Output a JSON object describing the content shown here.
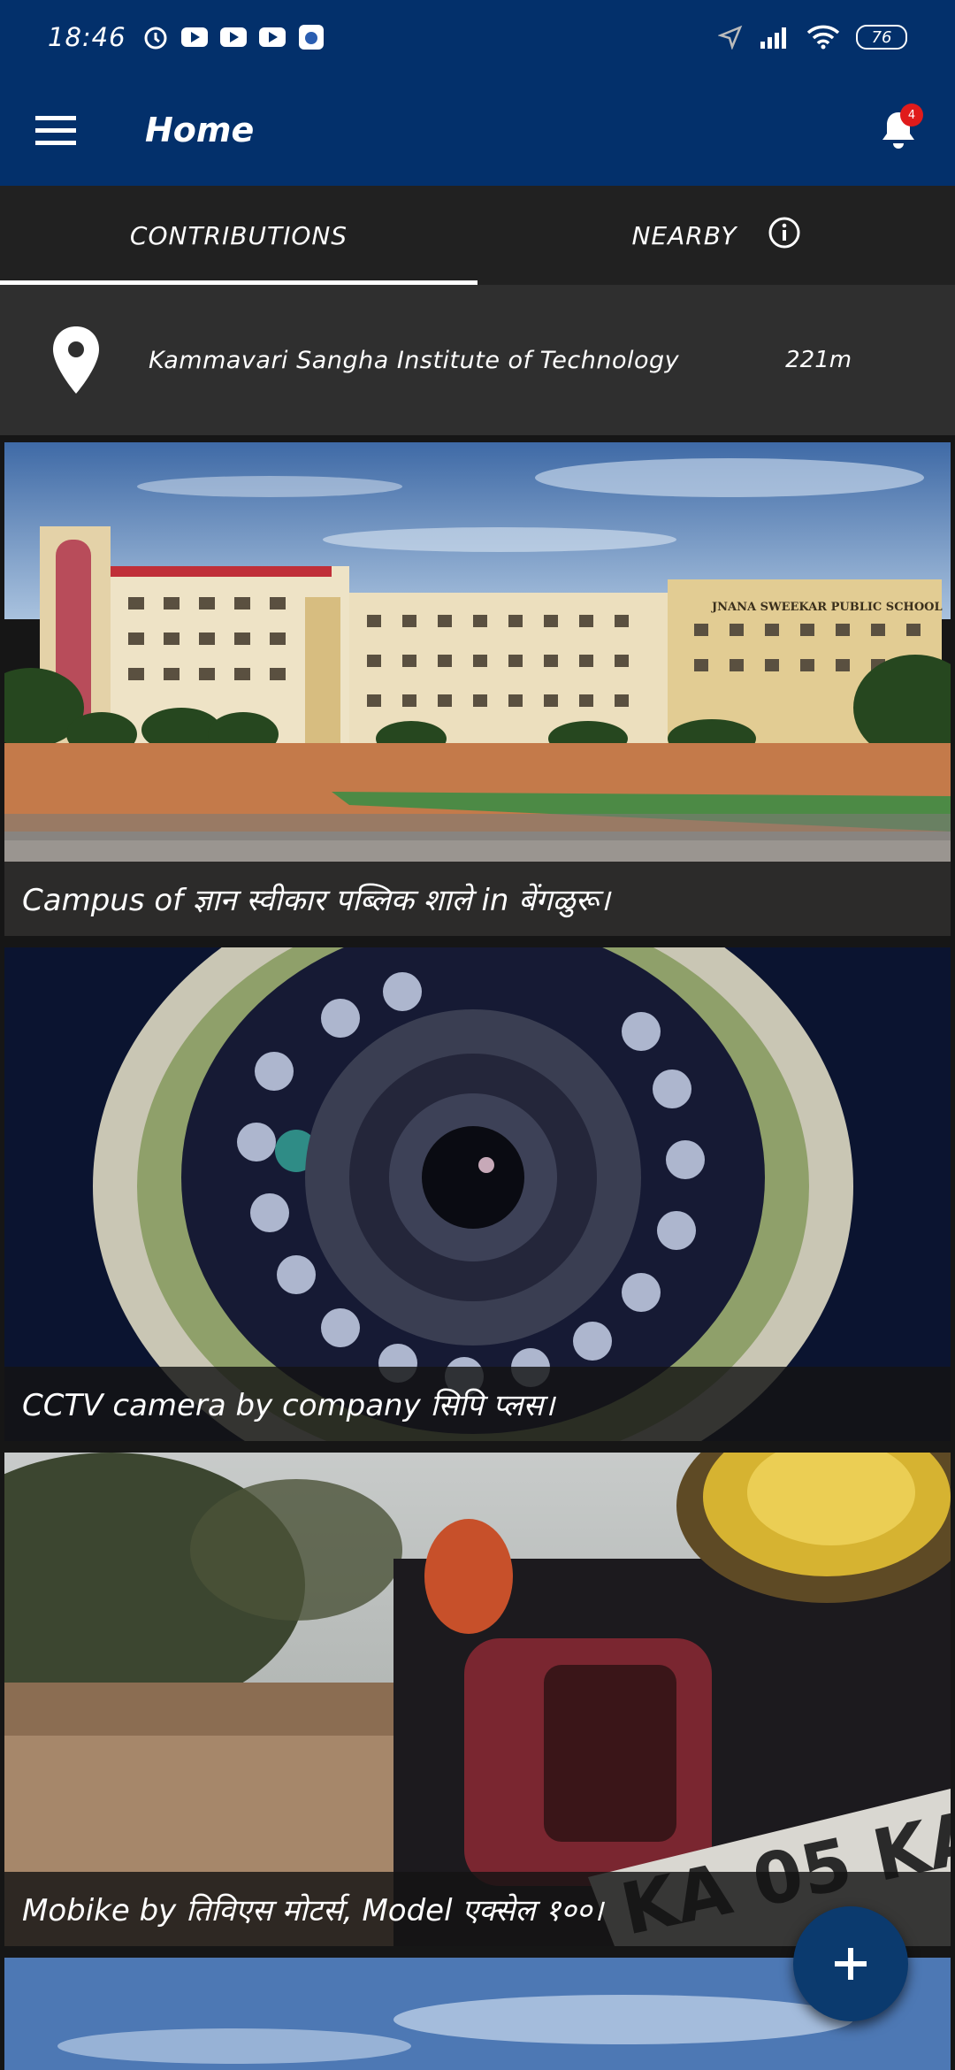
{
  "status_bar": {
    "time": "18:46",
    "battery": "76",
    "icons": [
      "alarm-icon",
      "youtube-icon",
      "youtube-icon",
      "youtube-icon",
      "app-icon",
      "location-arrow-icon",
      "signal-icon",
      "wifi-icon",
      "battery-icon"
    ]
  },
  "app_bar": {
    "title": "Home",
    "notification_count": "4"
  },
  "tabs": [
    {
      "label": "CONTRIBUTIONS",
      "active": true
    },
    {
      "label": "NEARBY",
      "active": false
    }
  ],
  "location": {
    "name": "Kammavari Sangha Institute of Technology",
    "distance": "221m"
  },
  "contributions": [
    {
      "caption": "Campus of ज्ञान स्वीकार पब्लिक शाले in बेंगळुरू।"
    },
    {
      "caption": "CCTV camera by company सिपि प्लस।"
    },
    {
      "caption": "Mobike by तिविएस मोटर्स, Model एक्सेल १००।"
    }
  ],
  "photo_texts": {
    "school_sign": "JNANA SWEEKAR PUBLIC SCHOOL",
    "license_plate": "KA 05 KA"
  }
}
